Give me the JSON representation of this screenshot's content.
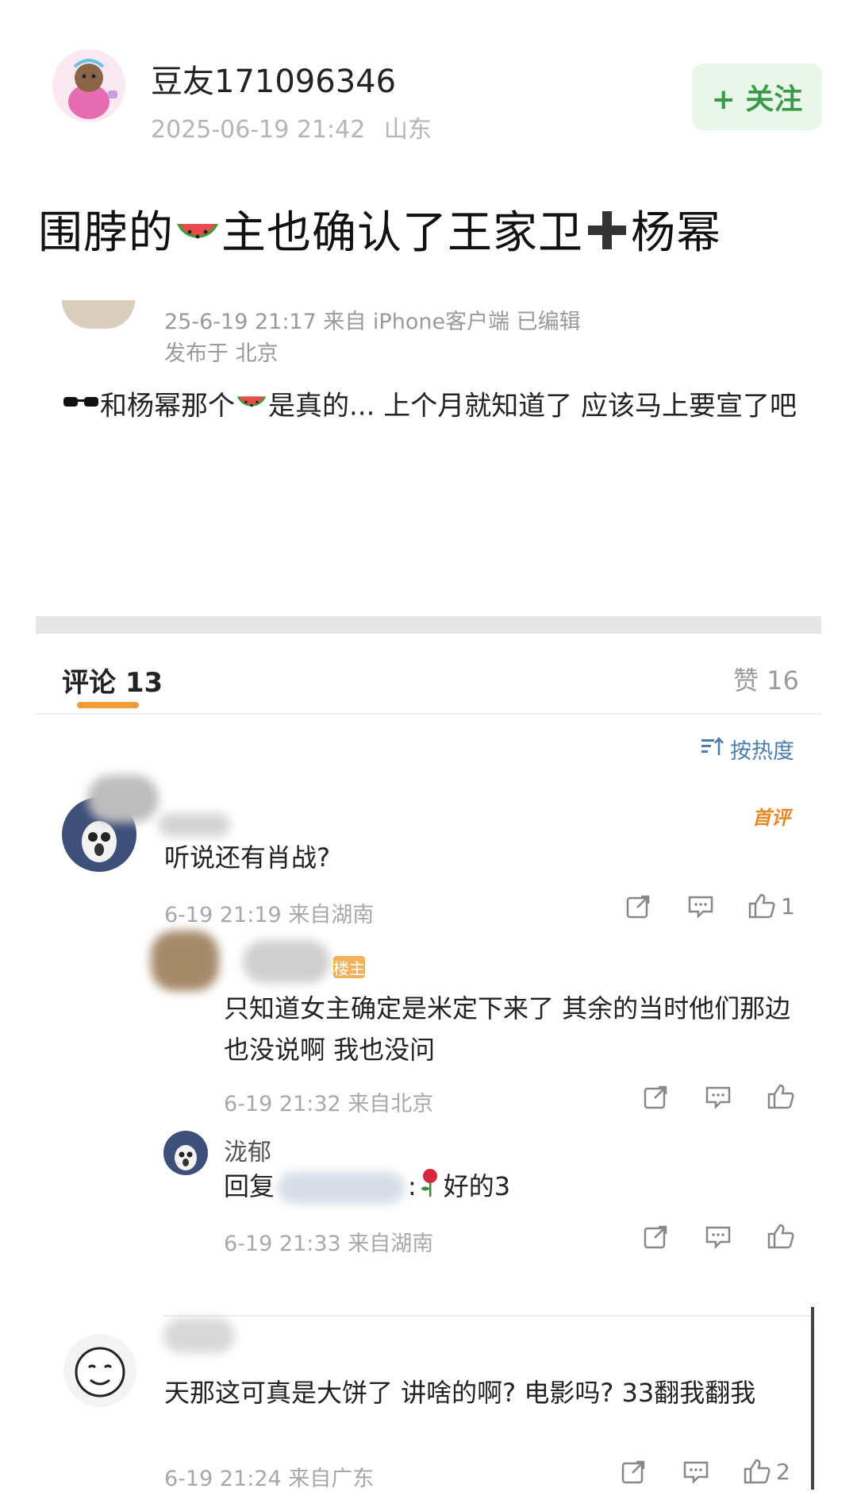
{
  "post": {
    "username": "豆友171096346",
    "timestamp": "2025-06-19 21:42",
    "location": "山东",
    "follow_label": "+ 关注",
    "headline_part1": "围脖的",
    "headline_part2": "主也确认了王家卫",
    "headline_part3": "杨幂"
  },
  "quoted": {
    "meta_line1": "25-6-19 21:17  来自 iPhone客户端  已编辑",
    "meta_line2": "发布于 北京",
    "text_part1": "和杨幂那个",
    "text_part2": "是真的... 上个月就知道了 应该马上要宣了吧"
  },
  "tabs": {
    "comments_label": "评论 13",
    "likes_label": "赞 16"
  },
  "sort_label": "按热度",
  "comments": [
    {
      "badge": "首评",
      "text": "听说还有肖战?",
      "meta": "6-19 21:19  来自湖南",
      "likes": "1"
    },
    {
      "badge": "楼主",
      "text": "只知道女主确定是米定下来了  其余的当时他们那边也没说啊 我也没问",
      "meta": "6-19 21:32  来自北京",
      "likes": ""
    },
    {
      "name": "泷郁",
      "reply_prefix": "回复",
      "reply_text": "好的3",
      "meta": "6-19 21:33  来自湖南",
      "likes": ""
    },
    {
      "text": "天那这可真是大饼了 讲啥的啊? 电影吗?  33翻我翻我",
      "meta": "6-19 21:24  来自广东",
      "likes": "2"
    }
  ],
  "icons": {
    "share": "share-icon",
    "reply": "reply-icon",
    "like": "thumbs-up-icon",
    "sort": "sort-icon"
  },
  "colors": {
    "follow_bg": "#e9f6ea",
    "follow_text": "#3a9a48",
    "tab_underline": "#f29a38",
    "sort_text": "#4e7ea8"
  }
}
